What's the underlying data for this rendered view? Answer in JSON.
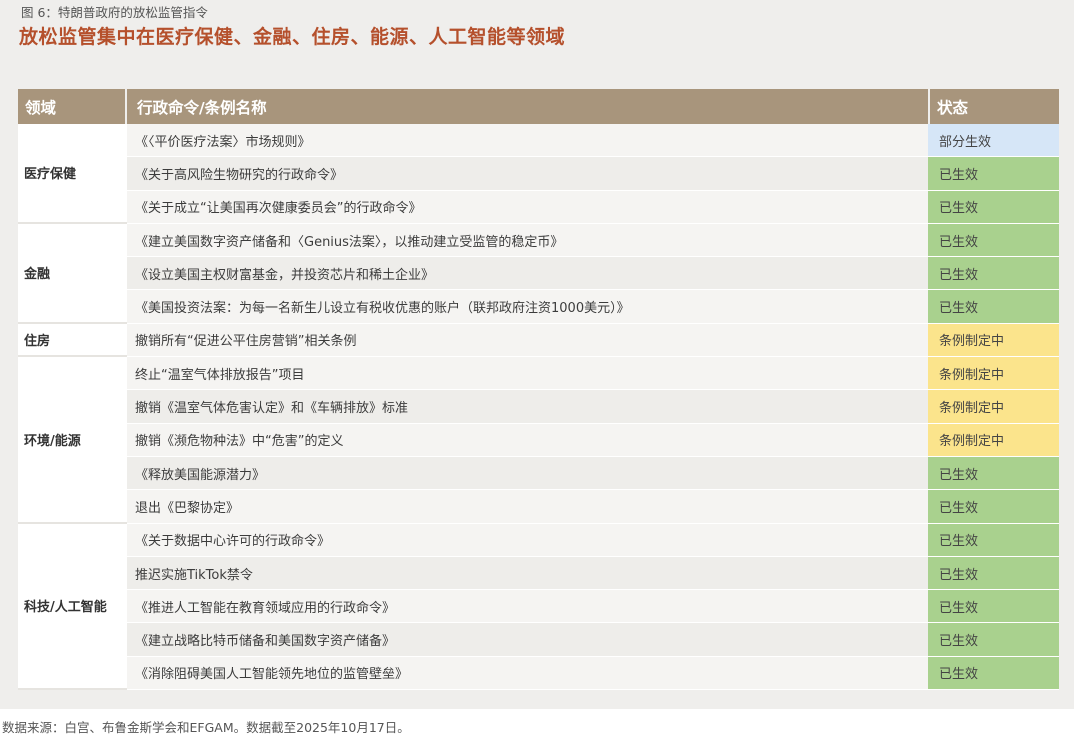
{
  "caption": "图 6：特朗普政府的放松监管指令",
  "subtitle": "放松监管集中在医疗保健、金融、住房、能源、人工智能等领域",
  "table": {
    "headers": {
      "domain": "领域",
      "name": "行政命令/条例名称",
      "status": "状态"
    },
    "groups": [
      {
        "domain": "医疗保健",
        "rows": [
          {
            "name": "《〈平价医疗法案〉市场规则》",
            "status": "部分生效",
            "type": "blue"
          },
          {
            "name": "《关于高风险生物研究的行政命令》",
            "status": "已生效",
            "type": "green"
          },
          {
            "name": "《关于成立“让美国再次健康委员会”的行政命令》",
            "status": "已生效",
            "type": "green"
          }
        ]
      },
      {
        "domain": "金融",
        "rows": [
          {
            "name": "《建立美国数字资产储备和〈Genius法案〉，以推动建立受监管的稳定币》",
            "status": "已生效",
            "type": "green"
          },
          {
            "name": "《设立美国主权财富基金，并投资芯片和稀土企业》",
            "status": "已生效",
            "type": "green"
          },
          {
            "name": "《美国投资法案：为每一名新生儿设立有税收优惠的账户（联邦政府注资1000美元）》",
            "status": "已生效",
            "type": "green"
          }
        ]
      },
      {
        "domain": "住房",
        "rows": [
          {
            "name": "撤销所有“促进公平住房营销”相关条例",
            "status": "条例制定中",
            "type": "yellow"
          }
        ]
      },
      {
        "domain": "环境/能源",
        "rows": [
          {
            "name": "终止“温室气体排放报告”项目",
            "status": "条例制定中",
            "type": "yellow"
          },
          {
            "name": "撤销《温室气体危害认定》和《车辆排放》标准",
            "status": "条例制定中",
            "type": "yellow"
          },
          {
            "name": "撤销《濒危物种法》中“危害”的定义",
            "status": "条例制定中",
            "type": "yellow"
          },
          {
            "name": "《释放美国能源潜力》",
            "status": "已生效",
            "type": "green"
          },
          {
            "name": "退出《巴黎协定》",
            "status": "已生效",
            "type": "green"
          }
        ]
      },
      {
        "domain": "科技/人工智能",
        "rows": [
          {
            "name": "《关于数据中心许可的行政命令》",
            "status": "已生效",
            "type": "green"
          },
          {
            "name": "推迟实施TikTok禁令",
            "status": "已生效",
            "type": "green"
          },
          {
            "name": "《推进人工智能在教育领域应用的行政命令》",
            "status": "已生效",
            "type": "green"
          },
          {
            "name": "《建立战略比特币储备和美国数字资产储备》",
            "status": "已生效",
            "type": "green"
          },
          {
            "name": "《消除阻碍美国人工智能领先地位的监管壁垒》",
            "status": "已生效",
            "type": "green"
          }
        ]
      }
    ]
  },
  "source": "数据来源：白宫、布鲁金斯学会和EFGAM。数据截至2025年10月17日。"
}
